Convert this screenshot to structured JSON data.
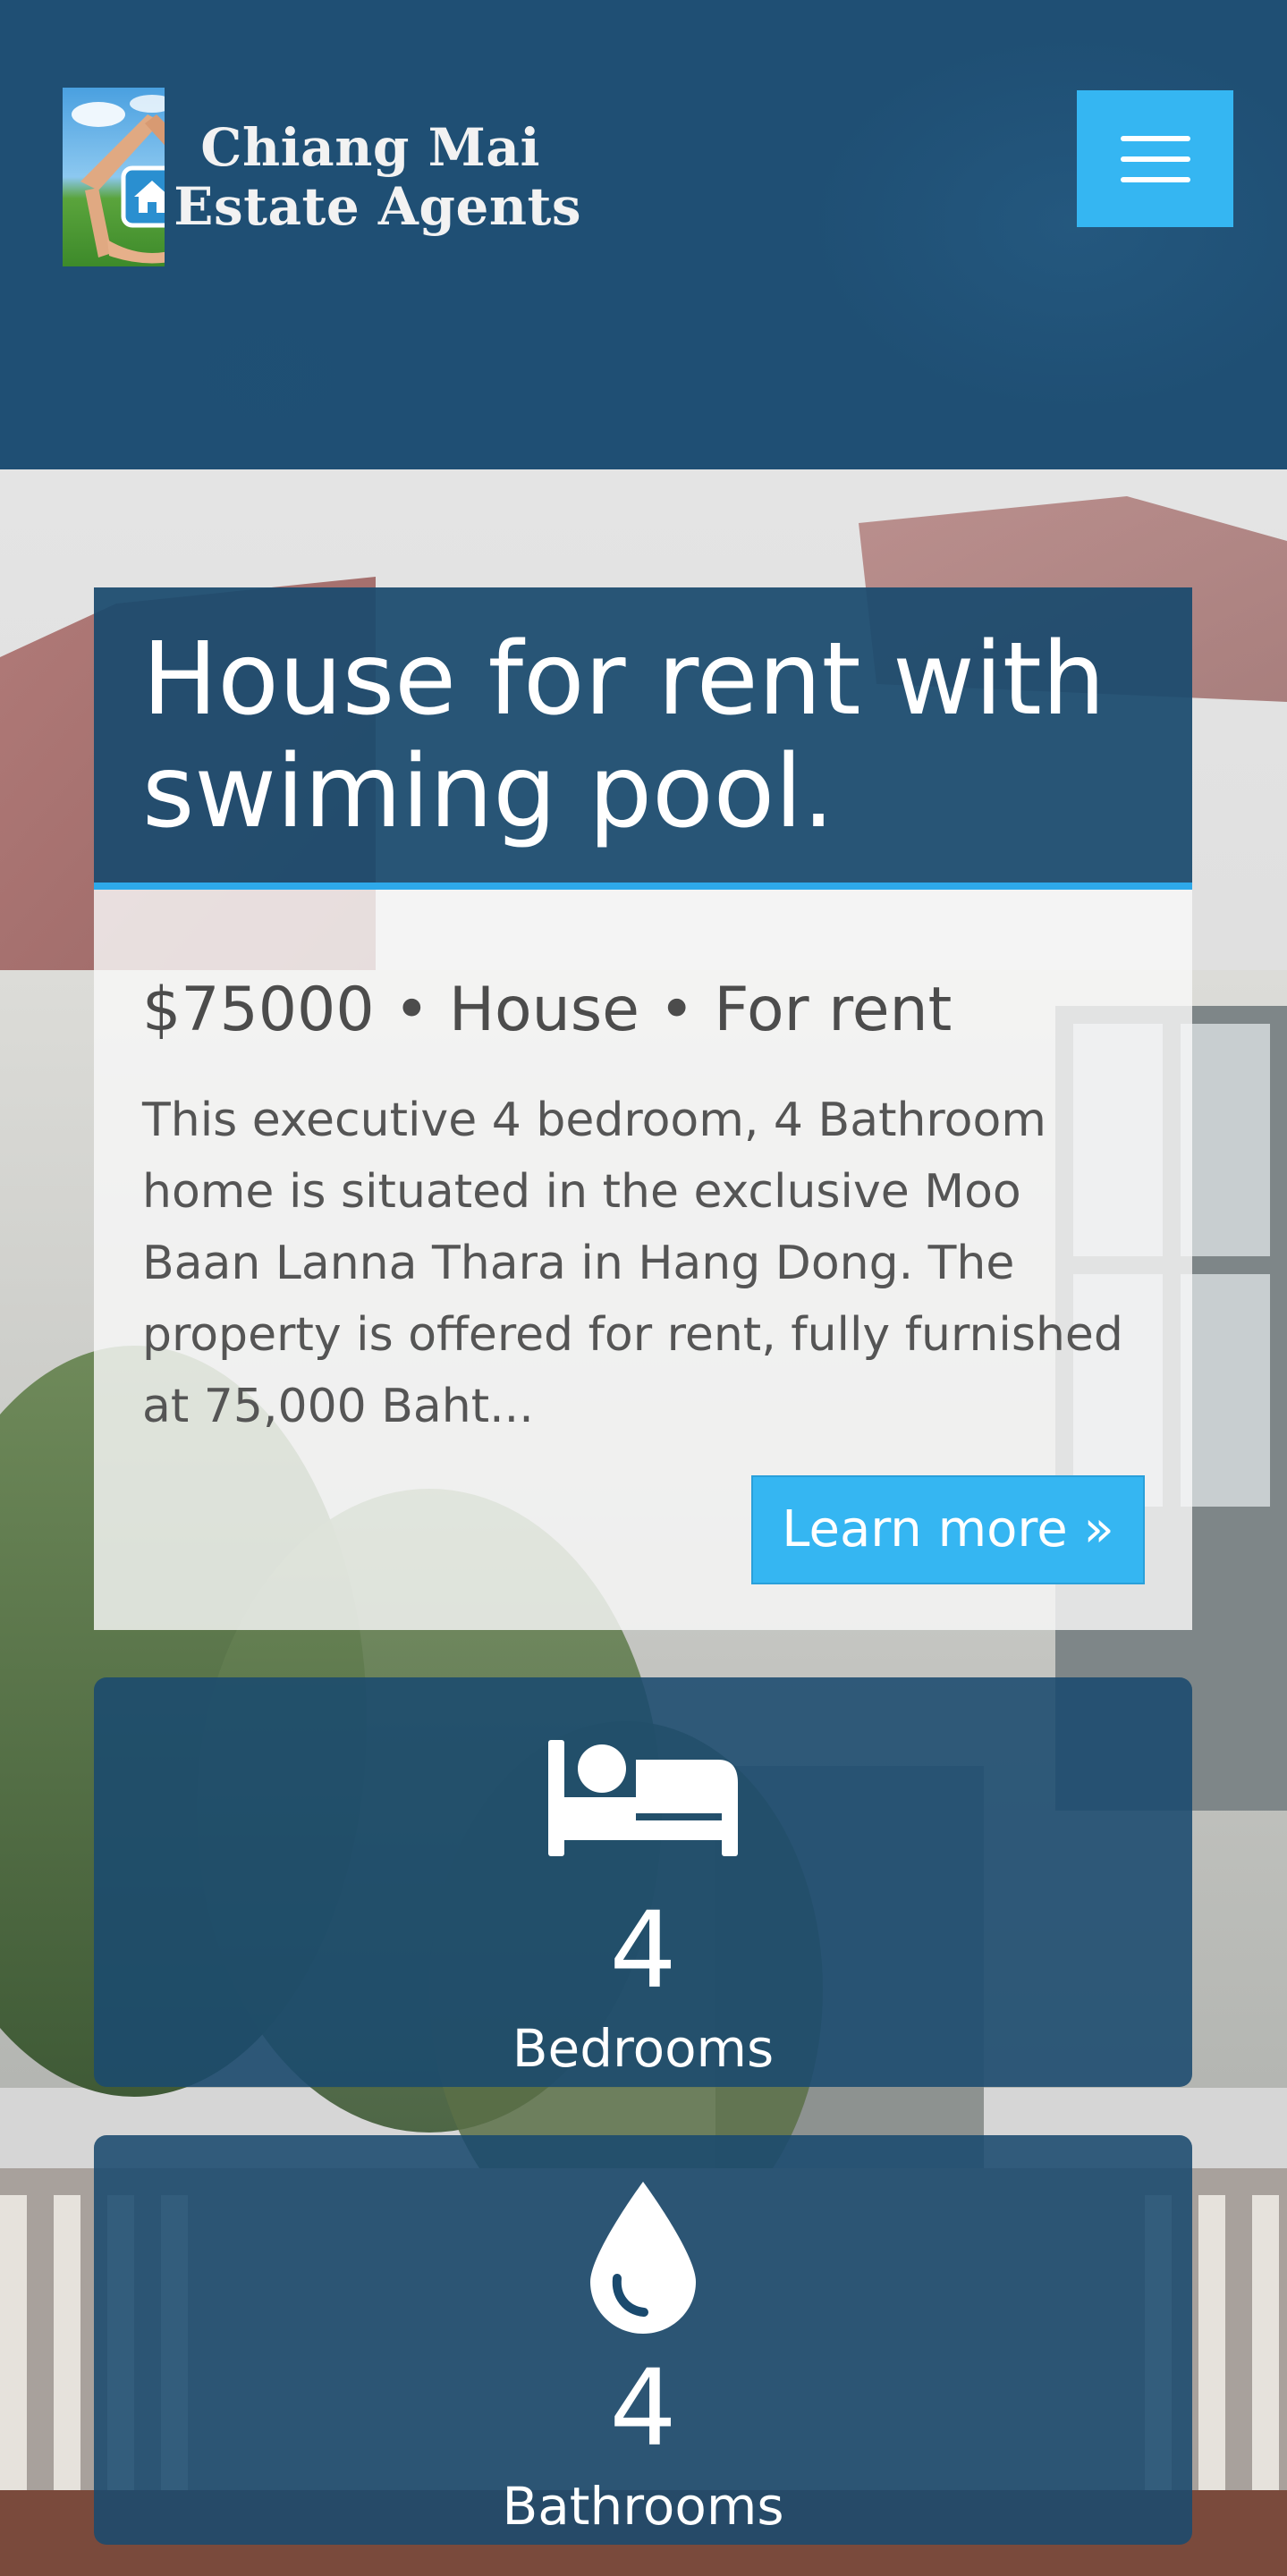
{
  "header": {
    "logo_line1": "Chiang Mai",
    "logo_line2": "Estate Agents",
    "logo_icon": "hands-house-logo",
    "menu_icon": "hamburger-menu-icon"
  },
  "listing": {
    "title": "House for rent with swiming pool.",
    "summary": "$75000 • House • For rent",
    "description": "This executive 4 bedroom, 4 Bathroom home is situated in the exclusive Moo Baan Lanna Thara in Hang Dong. The property is offered for rent, fully furnished at 75,000 Baht...",
    "learn_more_label": "Learn more »"
  },
  "stats": {
    "bedrooms": {
      "value": "4",
      "label": "Bedrooms",
      "icon": "bed-icon"
    },
    "bathrooms": {
      "value": "4",
      "label": "Bathrooms",
      "icon": "water-drop-icon"
    }
  },
  "colors": {
    "header_bg": "#1f4f74",
    "accent": "#35b6f2",
    "panel": "#1a4a6e"
  }
}
